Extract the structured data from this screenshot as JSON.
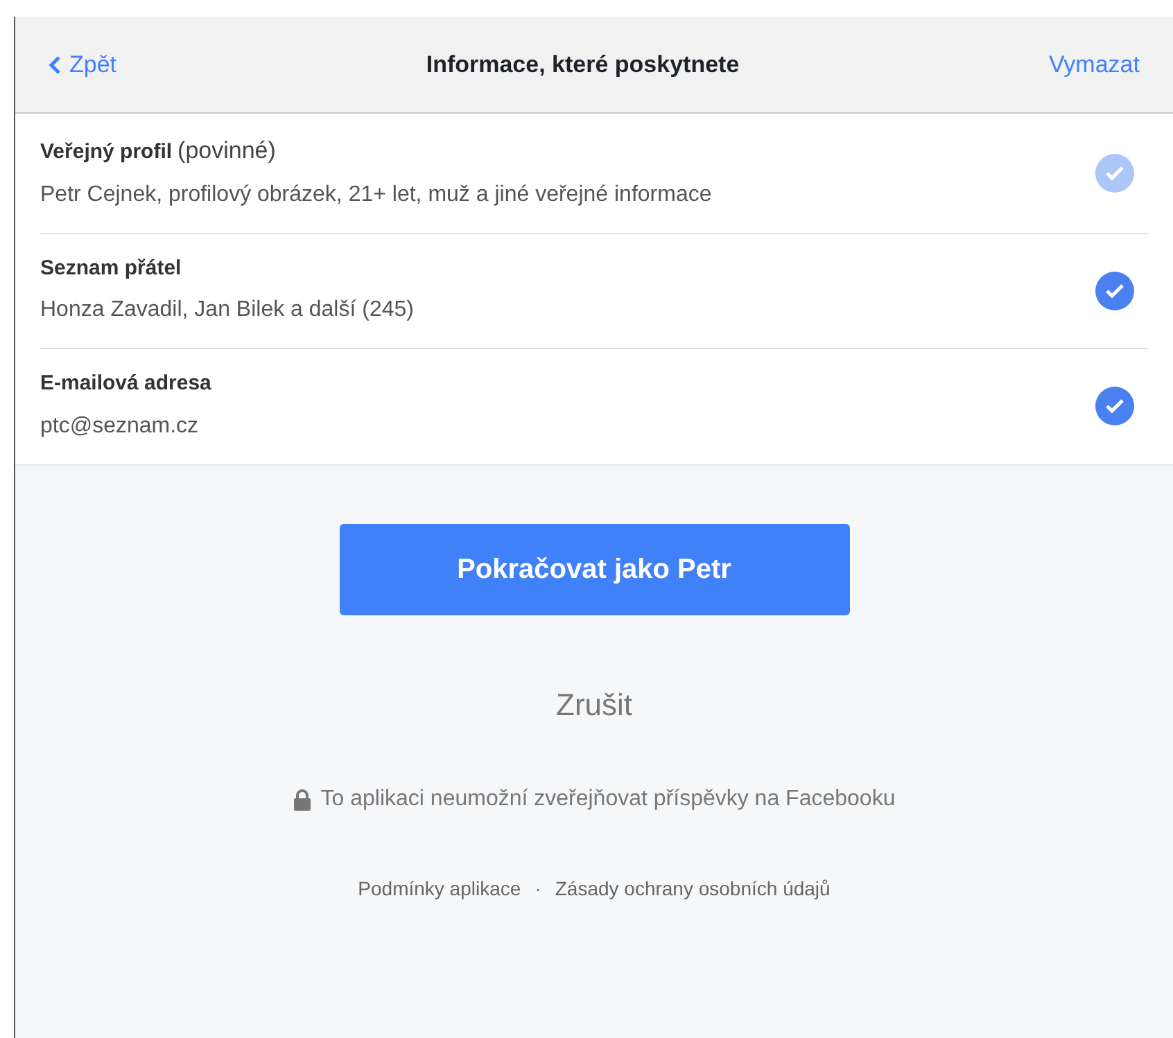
{
  "header": {
    "back": "Zpět",
    "title": "Informace, které poskytnete",
    "action": "Vymazat"
  },
  "items": [
    {
      "title": "Veřejný profil",
      "note": "(povinné)",
      "detail": "Petr Cejnek, profilový obrázek, 21+ let, muž a jiné veřejné informace",
      "checked": true,
      "disabled": true
    },
    {
      "title": "Seznam přátel",
      "detail": "Honza Zavadil, Jan Bilek a další (245)",
      "checked": true,
      "disabled": false
    },
    {
      "title": "E-mailová adresa",
      "detail": "ptc@seznam.cz",
      "checked": true,
      "disabled": false
    }
  ],
  "continue_button": "Pokračovat jako Petr",
  "cancel": "Zrušit",
  "notice": "To aplikaci neumožní zveřejňovat příspěvky na Facebooku",
  "links": [
    {
      "label": "Podmínky aplikace"
    },
    {
      "label": "Zásady ochrany osobních údajů"
    }
  ],
  "separator": "·"
}
